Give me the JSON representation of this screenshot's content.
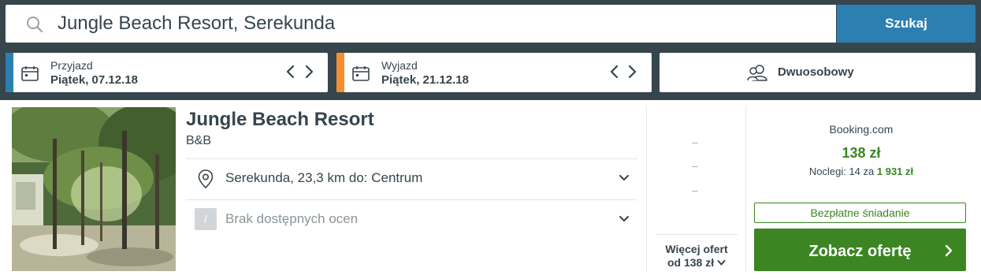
{
  "search": {
    "query": "Jungle Beach Resort, Serekunda",
    "button_label": "Szukaj"
  },
  "checkin": {
    "label": "Przyjazd",
    "value": "Piątek, 07.12.18"
  },
  "checkout": {
    "label": "Wyjazd",
    "value": "Piątek, 21.12.18"
  },
  "room": {
    "value": "Dwuosobowy"
  },
  "hotel": {
    "name": "Jungle Beach Resort",
    "type": "B&B",
    "location": "Serekunda, 23,3 km do: Centrum",
    "rating_badge": "/",
    "rating_text": "Brak dostępnych ocen"
  },
  "alt_offers": {
    "placeholders": [
      "–",
      "–",
      "–"
    ],
    "more_line1": "Więcej ofert",
    "more_line2": "od 138 zł"
  },
  "deal": {
    "provider": "Booking.com",
    "price": "138 zł",
    "nights_prefix": "Noclegi: 14 za",
    "nights_total": "1 931 zł",
    "badge": "Bezpłatne śniadanie",
    "cta_label": "Zobacz ofertę"
  },
  "colors": {
    "topbar": "#37454d",
    "search_button": "#2c80b1",
    "checkin_accent": "#2c80b1",
    "checkout_accent": "#f48f31",
    "deal_green": "#3b8622"
  },
  "icons": {
    "search": "search-icon",
    "calendar": "calendar-icon",
    "people": "people-icon",
    "location": "location-pin-icon",
    "chevron": "chevron-down-icon"
  }
}
